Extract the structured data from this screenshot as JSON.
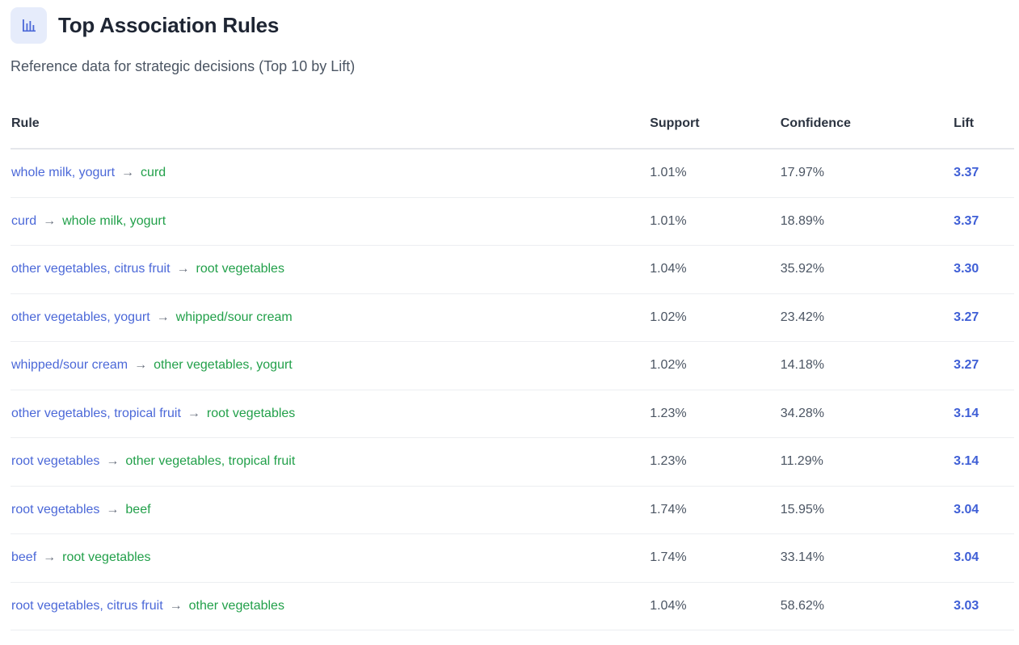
{
  "header": {
    "icon": "bar-chart-icon",
    "title": "Top Association Rules",
    "subtitle": "Reference data for strategic decisions (Top 10 by Lift)"
  },
  "table": {
    "columns": [
      "Rule",
      "Support",
      "Confidence",
      "Lift"
    ],
    "arrow": "→",
    "rows": [
      {
        "antecedent": "whole milk, yogurt",
        "consequent": "curd",
        "support": "1.01%",
        "confidence": "17.97%",
        "lift": "3.37"
      },
      {
        "antecedent": "curd",
        "consequent": "whole milk, yogurt",
        "support": "1.01%",
        "confidence": "18.89%",
        "lift": "3.37"
      },
      {
        "antecedent": "other vegetables, citrus fruit",
        "consequent": "root vegetables",
        "support": "1.04%",
        "confidence": "35.92%",
        "lift": "3.30"
      },
      {
        "antecedent": "other vegetables, yogurt",
        "consequent": "whipped/sour cream",
        "support": "1.02%",
        "confidence": "23.42%",
        "lift": "3.27"
      },
      {
        "antecedent": "whipped/sour cream",
        "consequent": "other vegetables, yogurt",
        "support": "1.02%",
        "confidence": "14.18%",
        "lift": "3.27"
      },
      {
        "antecedent": "other vegetables, tropical fruit",
        "consequent": "root vegetables",
        "support": "1.23%",
        "confidence": "34.28%",
        "lift": "3.14"
      },
      {
        "antecedent": "root vegetables",
        "consequent": "other vegetables, tropical fruit",
        "support": "1.23%",
        "confidence": "11.29%",
        "lift": "3.14"
      },
      {
        "antecedent": "root vegetables",
        "consequent": "beef",
        "support": "1.74%",
        "confidence": "15.95%",
        "lift": "3.04"
      },
      {
        "antecedent": "beef",
        "consequent": "root vegetables",
        "support": "1.74%",
        "confidence": "33.14%",
        "lift": "3.04"
      },
      {
        "antecedent": "root vegetables, citrus fruit",
        "consequent": "other vegetables",
        "support": "1.04%",
        "confidence": "58.62%",
        "lift": "3.03"
      }
    ]
  },
  "colors": {
    "antecedent": "#4b68d8",
    "consequent": "#22a04a",
    "lift": "#3f5fd6",
    "icon_bg": "#e6ecfb"
  }
}
